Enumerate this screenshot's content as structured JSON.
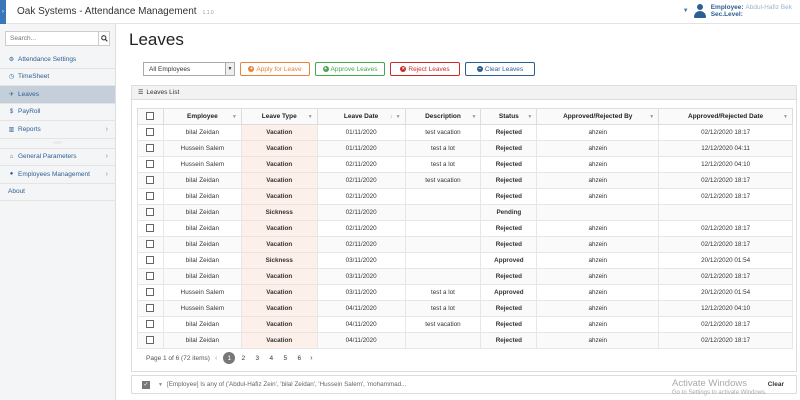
{
  "app": {
    "title": "Oak Systems - Attendance Management",
    "version": "1.1.0"
  },
  "user": {
    "employee_label": "Employee:",
    "employee_name": "Abdul-Hafiz Bek",
    "level_label": "Sec.Level:"
  },
  "sidebar": {
    "search_placeholder": "Search...",
    "items": [
      {
        "label": "Attendance Settings",
        "icon": "settings-icon"
      },
      {
        "label": "TimeSheet",
        "icon": "clock-icon"
      },
      {
        "label": "Leaves",
        "icon": "leaves-icon"
      },
      {
        "label": "PayRoll",
        "icon": "dollar-icon"
      },
      {
        "label": "Reports",
        "icon": "chart-icon"
      },
      {
        "label": "General Parameters",
        "icon": "bank-icon"
      },
      {
        "label": "Employees Management",
        "icon": "user-icon"
      },
      {
        "label": "About",
        "icon": ""
      }
    ]
  },
  "page": {
    "title": "Leaves"
  },
  "toolbar": {
    "employee_filter": "All Employees",
    "apply_label": "Apply for Leave",
    "approve_label": "Approve Leaves",
    "reject_label": "Reject Leaves",
    "clear_label": "Clear Leaves"
  },
  "panel": {
    "title": "Leaves List"
  },
  "table": {
    "columns": [
      "Employee",
      "Leave Type",
      "Leave Date",
      "Description",
      "Status",
      "Approved/Rejected By",
      "Approved/Rejected Date"
    ],
    "rows": [
      {
        "employee": "bilal Zeidan",
        "type": "Vacation",
        "date": "01/11/2020",
        "desc": "test vacation",
        "status": "Rejected",
        "by": "ahzein",
        "when": "02/12/2020 18:17"
      },
      {
        "employee": "Hussein Salem",
        "type": "Vacation",
        "date": "01/11/2020",
        "desc": "test a lot",
        "status": "Rejected",
        "by": "ahzein",
        "when": "12/12/2020 04:11"
      },
      {
        "employee": "Hussein Salem",
        "type": "Vacation",
        "date": "02/11/2020",
        "desc": "test a lot",
        "status": "Rejected",
        "by": "ahzein",
        "when": "12/12/2020 04:10"
      },
      {
        "employee": "bilal Zeidan",
        "type": "Vacation",
        "date": "02/11/2020",
        "desc": "test vacation",
        "status": "Rejected",
        "by": "ahzein",
        "when": "02/12/2020 18:17"
      },
      {
        "employee": "bilal Zeidan",
        "type": "Vacation",
        "date": "02/11/2020",
        "desc": "",
        "status": "Rejected",
        "by": "ahzein",
        "when": "02/12/2020 18:17"
      },
      {
        "employee": "bilal Zeidan",
        "type": "Sickness",
        "date": "02/11/2020",
        "desc": "",
        "status": "Pending",
        "by": "",
        "when": ""
      },
      {
        "employee": "bilal Zeidan",
        "type": "Vacation",
        "date": "02/11/2020",
        "desc": "",
        "status": "Rejected",
        "by": "ahzein",
        "when": "02/12/2020 18:17"
      },
      {
        "employee": "bilal Zeidan",
        "type": "Vacation",
        "date": "02/11/2020",
        "desc": "",
        "status": "Rejected",
        "by": "ahzein",
        "when": "02/12/2020 18:17"
      },
      {
        "employee": "bilal Zeidan",
        "type": "Sickness",
        "date": "03/11/2020",
        "desc": "",
        "status": "Approved",
        "by": "ahzein",
        "when": "20/12/2020 01:54"
      },
      {
        "employee": "bilal Zeidan",
        "type": "Vacation",
        "date": "03/11/2020",
        "desc": "",
        "status": "Rejected",
        "by": "ahzein",
        "when": "02/12/2020 18:17"
      },
      {
        "employee": "Hussein Salem",
        "type": "Vacation",
        "date": "03/11/2020",
        "desc": "test a lot",
        "status": "Approved",
        "by": "ahzein",
        "when": "20/12/2020 01:54"
      },
      {
        "employee": "Hussein Salem",
        "type": "Vacation",
        "date": "04/11/2020",
        "desc": "test a lot",
        "status": "Rejected",
        "by": "ahzein",
        "when": "12/12/2020 04:10"
      },
      {
        "employee": "bilal Zeidan",
        "type": "Vacation",
        "date": "04/11/2020",
        "desc": "test vacation",
        "status": "Rejected",
        "by": "ahzein",
        "when": "02/12/2020 18:17"
      },
      {
        "employee": "bilal Zeidan",
        "type": "Vacation",
        "date": "04/11/2020",
        "desc": "",
        "status": "Rejected",
        "by": "ahzein",
        "when": "02/12/2020 18:17"
      }
    ]
  },
  "pager": {
    "summary": "Page 1 of 6 (72 items)",
    "pages": [
      "1",
      "2",
      "3",
      "4",
      "5",
      "6"
    ],
    "current": "1"
  },
  "filter": {
    "text": "[Employee] Is any of ('Abdul-Hafiz Zein', 'bilal Zeidan', 'Hussein Salem', 'mohammad...",
    "clear_label": "Clear"
  },
  "watermark": {
    "title": "Activate Windows",
    "subtitle": "Go to Settings to activate Windows."
  }
}
